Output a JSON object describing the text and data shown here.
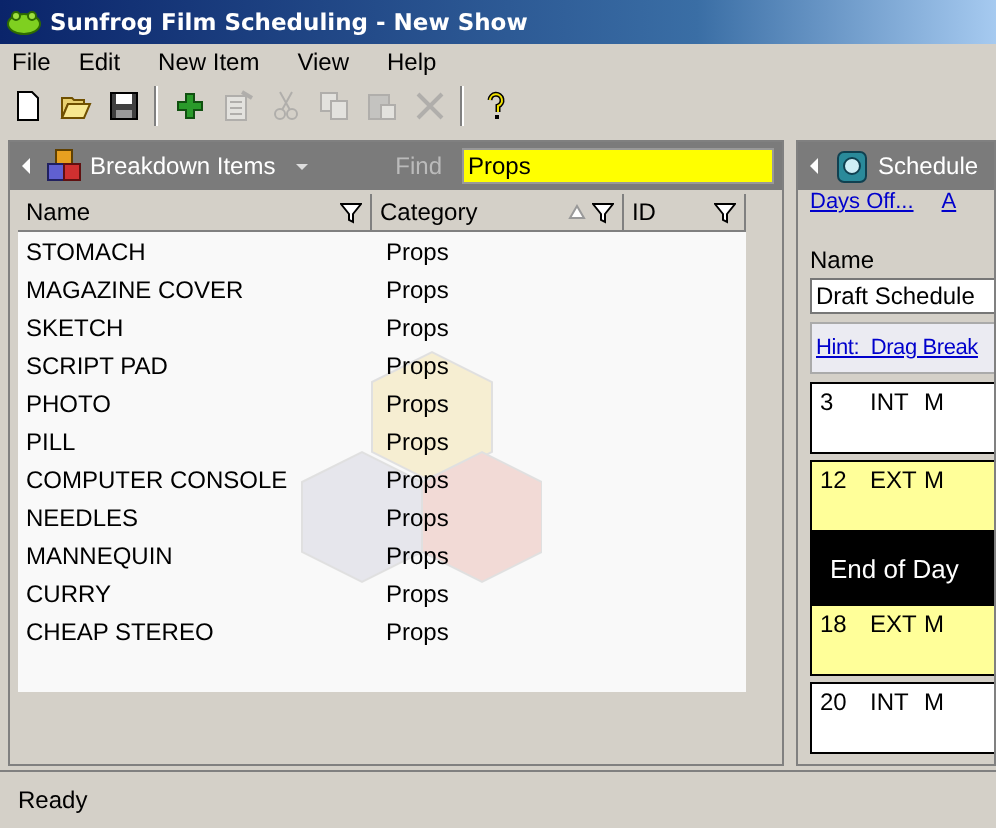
{
  "window": {
    "title": "Sunfrog Film Scheduling - New Show"
  },
  "menu": [
    {
      "label": "File"
    },
    {
      "label": "Edit"
    },
    {
      "label": "New Item"
    },
    {
      "label": "View"
    },
    {
      "label": "Help"
    }
  ],
  "toolbar": [
    {
      "kind": "new",
      "disabled": false
    },
    {
      "kind": "open",
      "disabled": false
    },
    {
      "kind": "save",
      "disabled": false
    },
    {
      "kind": "sep"
    },
    {
      "kind": "add",
      "disabled": false
    },
    {
      "kind": "properties",
      "disabled": true
    },
    {
      "kind": "cut",
      "disabled": true
    },
    {
      "kind": "copy",
      "disabled": true
    },
    {
      "kind": "paste",
      "disabled": true
    },
    {
      "kind": "delete",
      "disabled": true
    },
    {
      "kind": "sep"
    },
    {
      "kind": "help",
      "disabled": false
    }
  ],
  "breakdown_panel": {
    "title": "Breakdown Items",
    "find_label": "Find",
    "find_value": "Props",
    "columns": [
      {
        "label": "Name",
        "sorted": false
      },
      {
        "label": "Category",
        "sorted": true
      },
      {
        "label": "ID",
        "sorted": false
      }
    ],
    "rows": [
      {
        "name": "STOMACH",
        "category": "Props"
      },
      {
        "name": "MAGAZINE COVER",
        "category": "Props"
      },
      {
        "name": "SKETCH",
        "category": "Props"
      },
      {
        "name": "SCRIPT PAD",
        "category": "Props"
      },
      {
        "name": "PHOTO",
        "category": "Props"
      },
      {
        "name": "PILL",
        "category": "Props"
      },
      {
        "name": "COMPUTER CONSOLE",
        "category": "Props"
      },
      {
        "name": "NEEDLES",
        "category": "Props"
      },
      {
        "name": "MANNEQUIN",
        "category": "Props"
      },
      {
        "name": "CURRY",
        "category": "Props"
      },
      {
        "name": "CHEAP STEREO",
        "category": "Props"
      }
    ]
  },
  "schedule_panel": {
    "title": "Schedule",
    "links": [
      "Days Off...",
      "A"
    ],
    "name_label": "Name",
    "name_value": "Draft Schedule",
    "hint": "Hint:  Drag Break",
    "strips": [
      {
        "kind": "scene",
        "scene": "3",
        "setting": "INT",
        "column_3": "M",
        "color": "#ffffff"
      },
      {
        "kind": "scene",
        "scene": "12",
        "setting": "EXT",
        "column_3": "M",
        "color": "#ffff99"
      },
      {
        "kind": "day_break",
        "label": "End of Day"
      },
      {
        "kind": "scene",
        "scene": "18",
        "setting": "EXT",
        "column_3": "M",
        "color": "#ffff99"
      },
      {
        "kind": "scene",
        "scene": "20",
        "setting": "INT",
        "column_3": "M",
        "color": "#ffffff"
      }
    ]
  },
  "status_bar": {
    "text": "Ready"
  }
}
